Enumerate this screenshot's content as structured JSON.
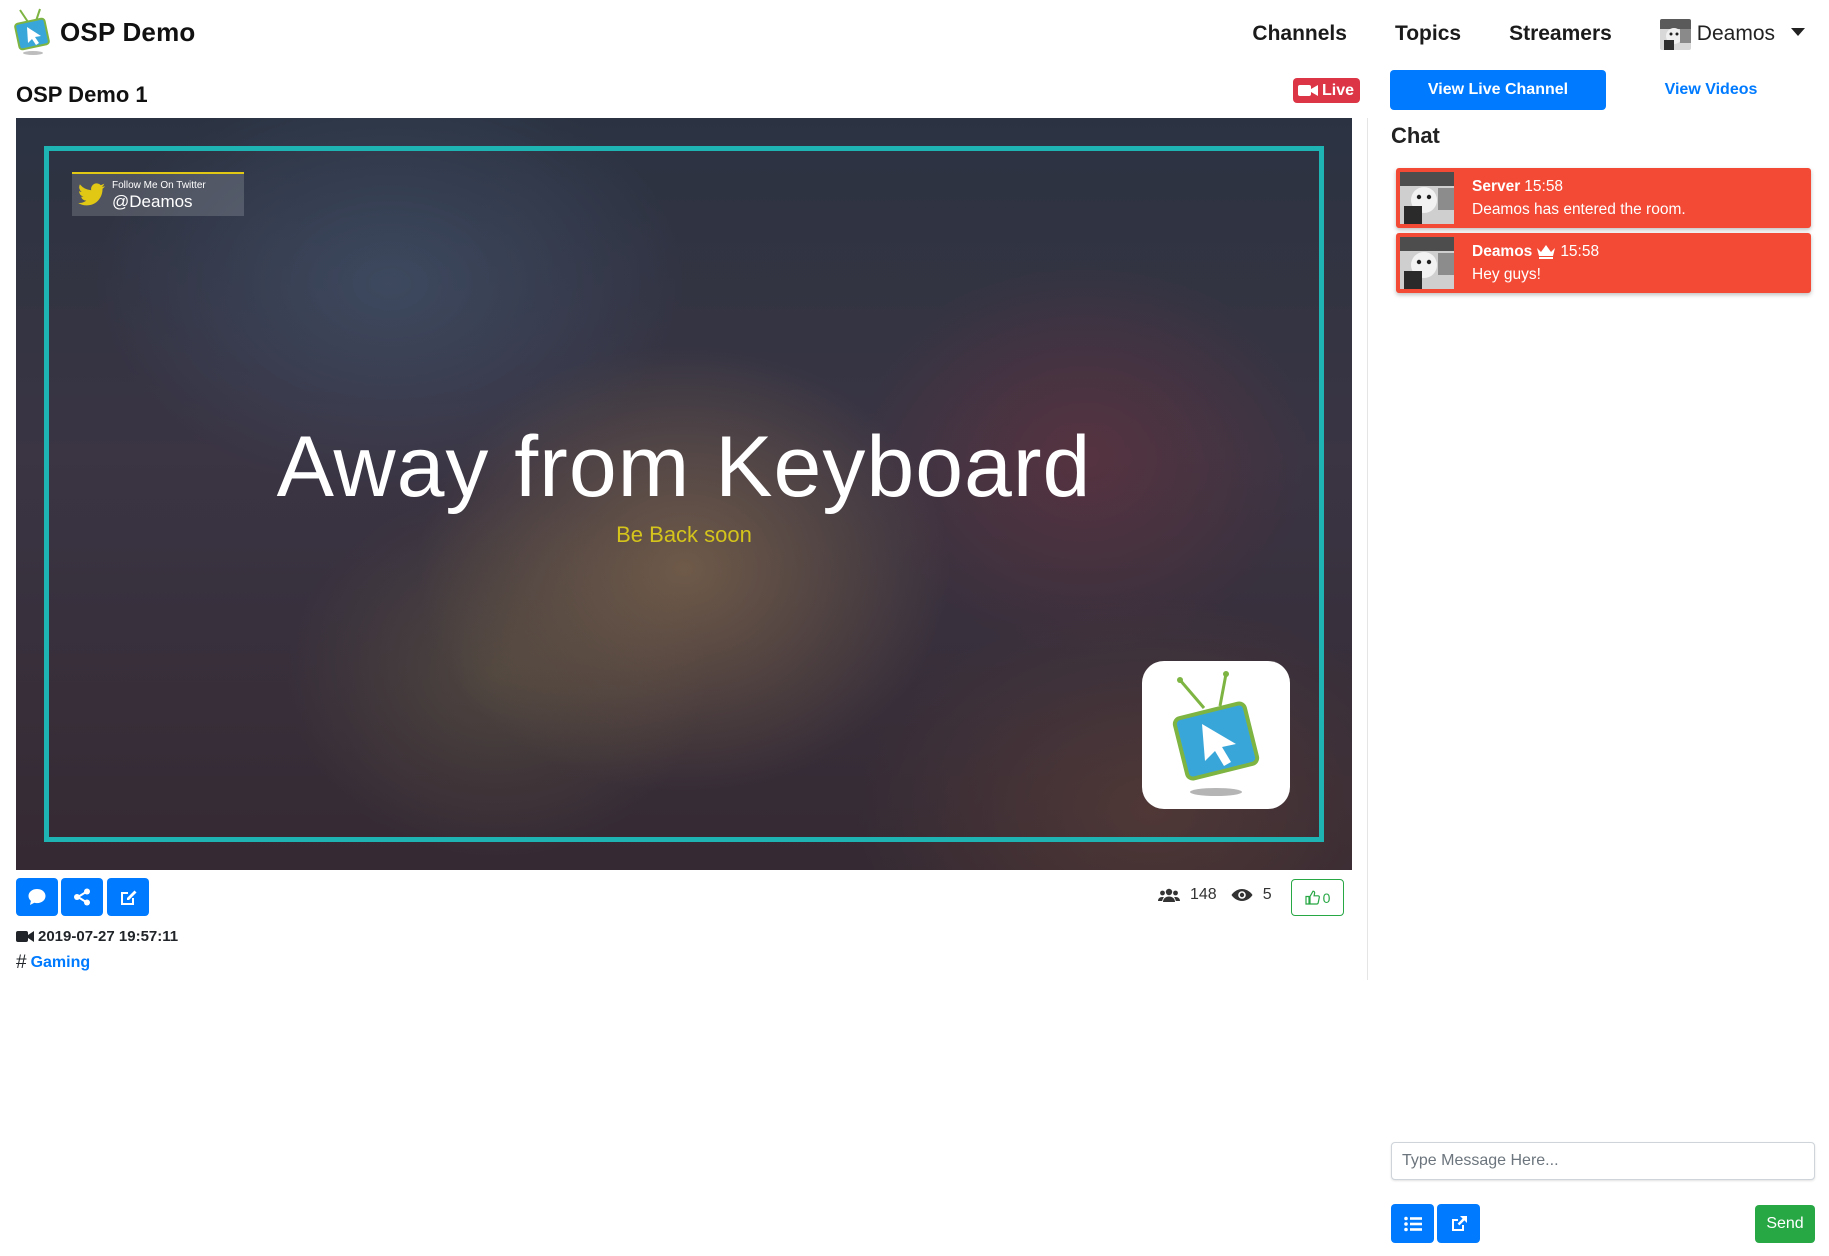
{
  "navbar": {
    "brand": "OSP Demo",
    "links": [
      "Channels",
      "Topics",
      "Streamers"
    ],
    "user": {
      "name": "Deamos"
    }
  },
  "stream": {
    "title": "OSP Demo 1",
    "live_label": "Live",
    "overlay": {
      "twitter_caption": "Follow Me On Twitter",
      "twitter_handle": "@Deamos",
      "headline": "Away from Keyboard",
      "subline": "Be Back soon"
    },
    "viewers": "148",
    "views": "5",
    "likes": "0",
    "start_time": "2019-07-27 19:57:11",
    "topic": "Gaming"
  },
  "actions": {
    "view_live_channel": "View Live Channel",
    "view_videos": "View Videos"
  },
  "chat": {
    "title": "Chat",
    "messages": [
      {
        "user": "Server",
        "time": "15:58",
        "text": "Deamos has entered the room.",
        "owner": false
      },
      {
        "user": "Deamos",
        "time": "15:58",
        "text": "Hey guys!",
        "owner": true
      }
    ],
    "input_placeholder": "Type Message Here...",
    "send_label": "Send"
  },
  "icons": {
    "brand": "osp-tv-logo-icon",
    "live": "video-camera-icon",
    "comment": "comment-icon",
    "share": "share-icon",
    "edit": "edit-icon",
    "viewers": "users-icon",
    "views": "eye-icon",
    "like": "thumbs-up-icon",
    "crown": "crown-icon",
    "list": "list-icon",
    "popout": "external-link-icon"
  },
  "colors": {
    "primary": "#007bff",
    "danger": "#dc3545",
    "success": "#28a745",
    "chat_bubble": "#f24a35",
    "overlay_frame": "#1fb4b4",
    "overlay_subline": "#d4c41b"
  }
}
